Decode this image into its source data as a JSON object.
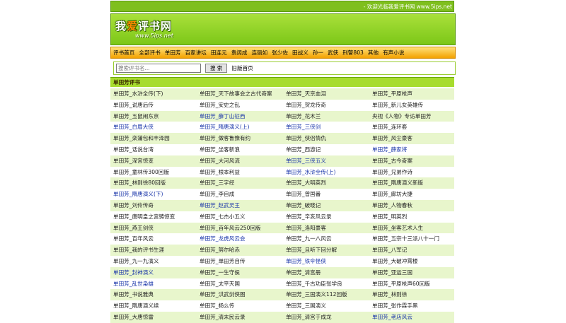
{
  "topbar": {
    "welcome": "- 欢迎光临我爱评书网 www.5ips.net"
  },
  "logo": {
    "main_a": "我",
    "main_b": "爱",
    "main_c": "评书网",
    "url": "www.5ips.net"
  },
  "nav": {
    "items": [
      "评书首页",
      "全部评书",
      "单田芳",
      "百家讲坛",
      "田连元",
      "袁阔成",
      "连丽如",
      "张少佐",
      "田战义",
      "孙一",
      "武侠",
      "刑警803",
      "其他",
      "有声小说"
    ]
  },
  "search": {
    "placeholder": "搜索评书名...",
    "button": "搜 索",
    "old_home": "旧版首页"
  },
  "section": {
    "title": "单田芳评书"
  },
  "colors": {
    "green_dark": "#7fbf1e",
    "green_light": "#e8f6cc",
    "orange": "#f3a200",
    "link_blue": "#1733a8"
  },
  "books": [
    {
      "t": "单田芳_水浒全传(下)",
      "b": false
    },
    {
      "t": "单田芳_天下故事会之古代奇案",
      "b": false
    },
    {
      "t": "单田芳_天京血泪",
      "b": false
    },
    {
      "t": "单田芳_平原枪声",
      "b": false
    },
    {
      "t": "单田芳_说唐后传",
      "b": false
    },
    {
      "t": "单田芳_安史之乱",
      "b": false
    },
    {
      "t": "单田芳_贺龙传奇",
      "b": false
    },
    {
      "t": "单田芳_新儿女英雄传",
      "b": false
    },
    {
      "t": "单田芳_五鼠闹东京",
      "b": false
    },
    {
      "t": "单田芳_薛丁山征西",
      "b": true
    },
    {
      "t": "单田芳_花木兰",
      "b": false
    },
    {
      "t": "央视《人物》专访单田芳",
      "b": false
    },
    {
      "t": "单田芳_白眉大侠",
      "b": true
    },
    {
      "t": "单田芳_隋唐演义(上)",
      "b": true
    },
    {
      "t": "单田芳_三侠剑",
      "b": true
    },
    {
      "t": "单田芳_连环套",
      "b": false
    },
    {
      "t": "单田芳_栾蒲包和丰泽园",
      "b": false
    },
    {
      "t": "单田芳_做客鲁豫有约",
      "b": false
    },
    {
      "t": "单田芳_侠侣情仇",
      "b": false
    },
    {
      "t": "单田芳_风尘豪客",
      "b": false
    },
    {
      "t": "单田芳_话说台湾",
      "b": false
    },
    {
      "t": "单田芳_坐客新浪",
      "b": false
    },
    {
      "t": "单田芳_西游记",
      "b": false
    },
    {
      "t": "单田芳_薛家将",
      "b": true
    },
    {
      "t": "单田芳_深宫惊变",
      "b": false
    },
    {
      "t": "单田芳_大河风流",
      "b": false
    },
    {
      "t": "单田芳_三侠五义",
      "b": true
    },
    {
      "t": "单田芳_古今奇案",
      "b": false
    },
    {
      "t": "单田芳_童林传300回版",
      "b": false
    },
    {
      "t": "单田芳_根本利益",
      "b": false
    },
    {
      "t": "单田芳_水浒全传(上)",
      "b": true
    },
    {
      "t": "单田芳_兄弟作诗",
      "b": false
    },
    {
      "t": "单田芳_林则徐80回版",
      "b": false
    },
    {
      "t": "单田芳_三字经",
      "b": false
    },
    {
      "t": "单田芳_大明英烈",
      "b": false
    },
    {
      "t": "单田芳_隋唐演义新版",
      "b": false
    },
    {
      "t": "单田芳_隋唐演义(下)",
      "b": true
    },
    {
      "t": "单田芳_李自成",
      "b": false
    },
    {
      "t": "单田芳_曾国番",
      "b": false
    },
    {
      "t": "单田芳_廊坊大捷",
      "b": false
    },
    {
      "t": "单田芳_刘伶传奇",
      "b": false
    },
    {
      "t": "单田芳_赵武灵王",
      "b": true
    },
    {
      "t": "单田芳_破晓记",
      "b": false
    },
    {
      "t": "单田芳_人物春秋",
      "b": false
    },
    {
      "t": "单田芳_唐明皇之宫铸惊变",
      "b": false
    },
    {
      "t": "单田芳_七杰小五义",
      "b": false
    },
    {
      "t": "单田芳_辛亥风云录",
      "b": false
    },
    {
      "t": "单田芳_明英烈",
      "b": false
    },
    {
      "t": "单田芳_燕王剑侠",
      "b": false
    },
    {
      "t": "单田芳_百年风云250回版",
      "b": false
    },
    {
      "t": "单田芳_洛阳豪客",
      "b": false
    },
    {
      "t": "单田芳_坐客艺术人生",
      "b": false
    },
    {
      "t": "单田芳_百年风云",
      "b": false
    },
    {
      "t": "单田芳_龙虎风云会",
      "b": true
    },
    {
      "t": "单田芳_九一八风云",
      "b": false
    },
    {
      "t": "单田芳_五宗十三派八十一门",
      "b": false
    },
    {
      "t": "单田芳_我的评书生涯",
      "b": false
    },
    {
      "t": "单田芳_努尔哈赤",
      "b": false
    },
    {
      "t": "单田芳_且听下回分解",
      "b": false
    },
    {
      "t": "单田芳_八军记",
      "b": false
    },
    {
      "t": "单田芳_九一九演义",
      "b": false
    },
    {
      "t": "单田芳_单田芳自传",
      "b": false
    },
    {
      "t": "单田芳_铁伞怪侠",
      "b": true
    },
    {
      "t": "单田芳_大破冲霄楼",
      "b": false
    },
    {
      "t": "单田芳_封神演义",
      "b": true
    },
    {
      "t": "单田芳_一生守侯",
      "b": false
    },
    {
      "t": "单田芳_清宫册",
      "b": false
    },
    {
      "t": "单田芳_亚运三国",
      "b": false
    },
    {
      "t": "单田芳_乱世枭雄",
      "b": true
    },
    {
      "t": "单田芳_太平天国",
      "b": false
    },
    {
      "t": "单田芳_千古功臣张学良",
      "b": false
    },
    {
      "t": "单田芳_平原枪声60回版",
      "b": false
    },
    {
      "t": "单田芳_书说雅典",
      "b": false
    },
    {
      "t": "单田芳_洪武剑侠图",
      "b": false
    },
    {
      "t": "单田芳_三国演义112回版",
      "b": false
    },
    {
      "t": "单田芳_林则徐",
      "b": false
    },
    {
      "t": "单田芳_隋唐演义续",
      "b": false
    },
    {
      "t": "单田芳_杨么传",
      "b": false
    },
    {
      "t": "单田芳_三国演义",
      "b": false
    },
    {
      "t": "单田芳_张作霖手黑",
      "b": false
    },
    {
      "t": "单田芳_大唐惊雷",
      "b": false
    },
    {
      "t": "单田芳_清末民云录",
      "b": false
    },
    {
      "t": "单田芳_清宫于成龙",
      "b": false
    },
    {
      "t": "单田芳_老店风云",
      "b": true
    }
  ]
}
